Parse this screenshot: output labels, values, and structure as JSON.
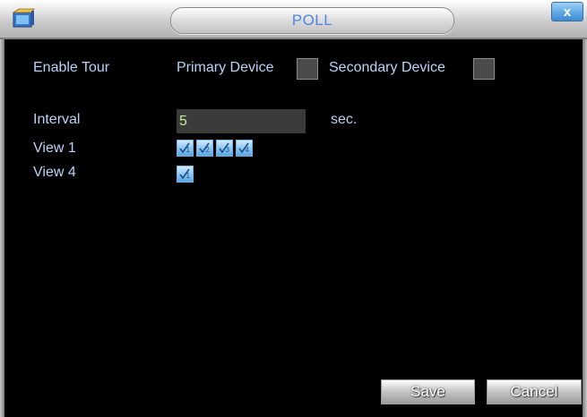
{
  "window": {
    "title": "POLL",
    "close_label": "x"
  },
  "tour": {
    "enable_label": "Enable Tour",
    "primary_label": "Primary Device",
    "primary_checked": false,
    "secondary_label": "Secondary Device",
    "secondary_checked": false
  },
  "interval": {
    "label": "Interval",
    "value": "5",
    "unit": "sec."
  },
  "views": [
    {
      "label": "View 1",
      "channels": [
        "1",
        "2",
        "3",
        "4"
      ]
    },
    {
      "label": "View 4",
      "channels": [
        "1"
      ]
    }
  ],
  "buttons": {
    "save": "Save",
    "cancel": "Cancel"
  },
  "colors": {
    "label_text": "#b9d4f6",
    "title_text": "#4f86e0",
    "input_value": "#c4e89a",
    "background": "#000000"
  },
  "icons": {
    "app": "folder-camera-icon",
    "close": "close-icon",
    "channel": "channel-checkmark-icon"
  }
}
